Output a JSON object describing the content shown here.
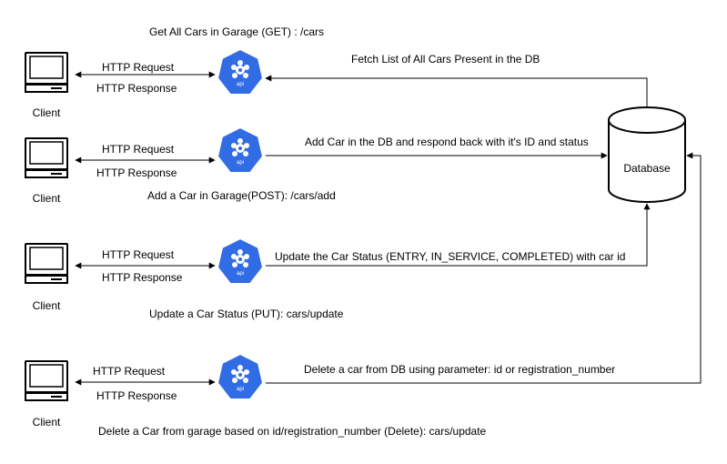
{
  "colors": {
    "api_blue": "#326CE5",
    "line": "#000000",
    "background": "#ffffff"
  },
  "icons": {
    "client": "computer-icon",
    "api": "api-hexagon-icon",
    "database": "database-cylinder-icon"
  },
  "database": {
    "label": "Database"
  },
  "api_icon_text": "api",
  "rows": [
    {
      "client_label": "Client",
      "request_label": "HTTP Request",
      "response_label": "HTTP Response",
      "endpoint": "Get All Cars in Garage (GET) : /cars",
      "db_action": "Fetch List of All Cars Present in the DB"
    },
    {
      "client_label": "Client",
      "request_label": "HTTP Request",
      "response_label": "HTTP Response",
      "endpoint": "Add a Car in Garage(POST): /cars/add",
      "db_action": "Add Car in the DB and respond back with it's ID and status"
    },
    {
      "client_label": "Client",
      "request_label": "HTTP Request",
      "response_label": "HTTP Response",
      "endpoint": "Update a Car Status (PUT): cars/update",
      "db_action": "Update the Car Status (ENTRY, IN_SERVICE, COMPLETED) with car id"
    },
    {
      "client_label": "Client",
      "request_label": "HTTP Request",
      "response_label": "HTTP Response",
      "endpoint": "Delete a Car from garage based on id/registration_number (Delete): cars/update",
      "db_action": "Delete a car from DB using parameter: id or registration_number"
    }
  ]
}
